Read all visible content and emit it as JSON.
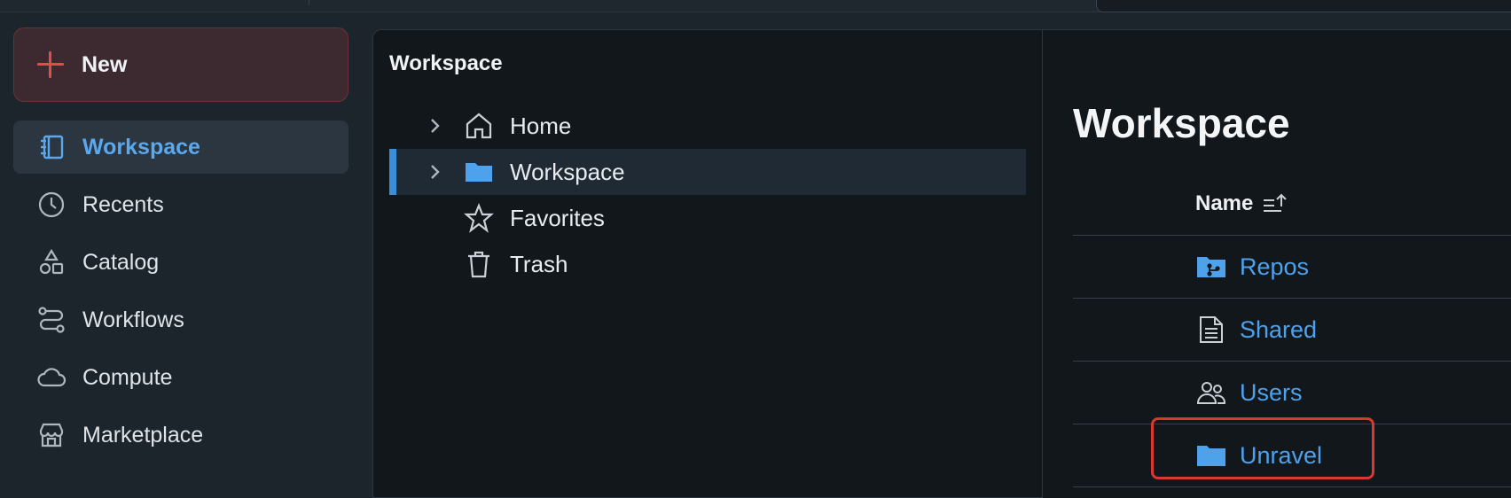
{
  "sidebar": {
    "new_label": "New",
    "items": [
      {
        "label": "Workspace",
        "icon": "workspace-icon",
        "active": true
      },
      {
        "label": "Recents",
        "icon": "clock-icon"
      },
      {
        "label": "Catalog",
        "icon": "catalog-icon"
      },
      {
        "label": "Workflows",
        "icon": "workflows-icon"
      },
      {
        "label": "Compute",
        "icon": "cloud-icon"
      },
      {
        "label": "Marketplace",
        "icon": "store-icon"
      }
    ]
  },
  "tree": {
    "title": "Workspace",
    "items": [
      {
        "label": "Home",
        "icon": "home-icon",
        "expandable": true
      },
      {
        "label": "Workspace",
        "icon": "folder-icon",
        "expandable": true,
        "selected": true
      },
      {
        "label": "Favorites",
        "icon": "star-icon",
        "expandable": false
      },
      {
        "label": "Trash",
        "icon": "trash-icon",
        "expandable": false
      }
    ]
  },
  "content": {
    "title": "Workspace",
    "column_name": "Name",
    "rows": [
      {
        "label": "Repos",
        "icon": "repos-folder-icon"
      },
      {
        "label": "Shared",
        "icon": "shared-doc-icon"
      },
      {
        "label": "Users",
        "icon": "users-icon"
      },
      {
        "label": "Unravel",
        "icon": "folder-icon",
        "highlighted": true
      }
    ]
  },
  "colors": {
    "accent": "#4ea2ec",
    "new_button_bg": "#3c2a30",
    "highlight": "#d8382e"
  }
}
